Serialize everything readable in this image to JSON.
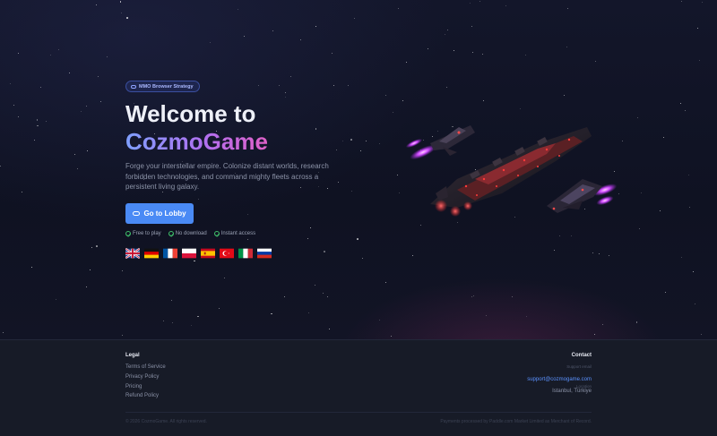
{
  "hero": {
    "badge": "MMO Browser Strategy",
    "title_line1": "Welcome to",
    "title_line2": "CozmoGame",
    "description": "Forge your interstellar empire. Colonize distant worlds, research forbidden technologies, and command mighty fleets across a persistent living galaxy.",
    "cta_label": "Go to Lobby",
    "features": [
      "Free to play",
      "No download",
      "Instant access"
    ],
    "languages": [
      "English",
      "German",
      "French",
      "Polish",
      "Spanish",
      "Turkish",
      "Italian",
      "Russian"
    ]
  },
  "footer": {
    "legal_heading": "Legal",
    "legal_links": [
      "Terms of Service",
      "Privacy Policy",
      "Pricing",
      "Refund Policy"
    ],
    "contact_heading": "Contact",
    "support_label": "Support email",
    "support_email": "support@cozmogame.com",
    "location_label": "Location",
    "location": "Istanbul, Türkiye",
    "copyright": "© 2026 CozmoGame. All rights reserved.",
    "payments_note": "Payments processed by Paddle.com Market Limited as Merchant of Record."
  },
  "colors": {
    "accent": "#4a8af5",
    "brand_gradient": [
      "#7fa0ff",
      "#b070f0",
      "#e060c8"
    ],
    "check": "#3fbf6a"
  }
}
